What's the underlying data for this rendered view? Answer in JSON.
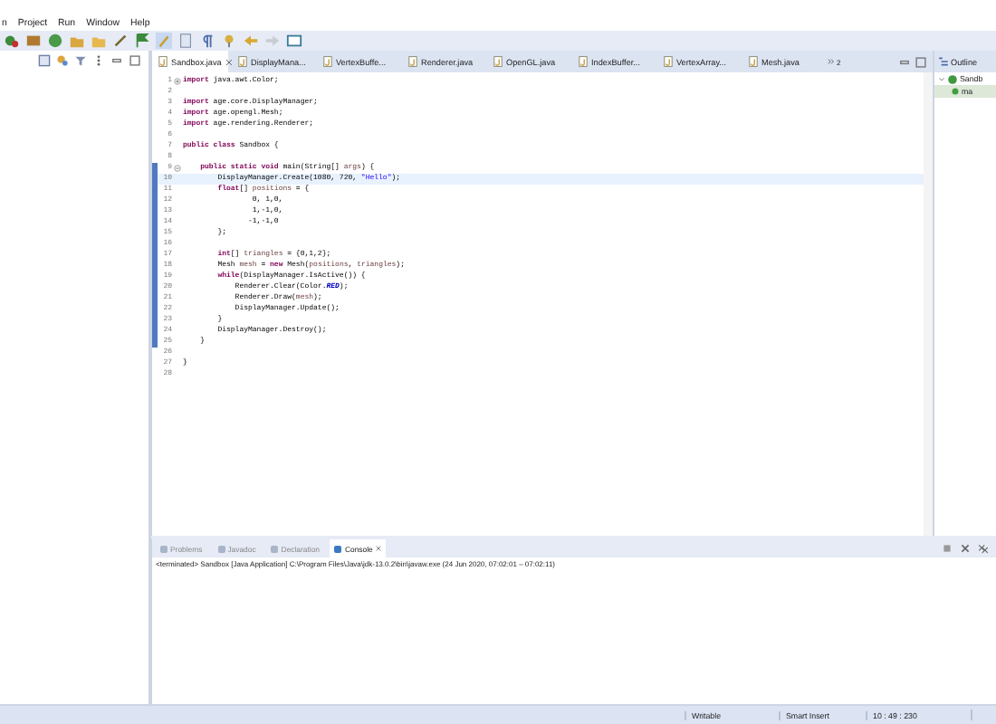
{
  "menu": [
    "n",
    "Project",
    "Run",
    "Window",
    "Help"
  ],
  "editor": {
    "tabs": [
      {
        "label": "Sandbox.java",
        "selected": true
      },
      {
        "label": "DisplayMana...",
        "selected": false
      },
      {
        "label": "VertexBuffe...",
        "selected": false
      },
      {
        "label": "Renderer.java",
        "selected": false
      },
      {
        "label": "OpenGL.java",
        "selected": false
      },
      {
        "label": "IndexBuffer...",
        "selected": false
      },
      {
        "label": "VertexArray...",
        "selected": false
      },
      {
        "label": "Mesh.java",
        "selected": false
      }
    ],
    "overflow_count": "2",
    "lines": [
      {
        "num": "1",
        "folded": true,
        "changed": false,
        "current": false,
        "segments": [
          {
            "t": "import",
            "kind": "kw"
          },
          {
            "t": " java.awt.Color;"
          }
        ]
      },
      {
        "num": "2",
        "changed": false,
        "current": false
      },
      {
        "num": "3",
        "changed": false,
        "current": false,
        "segments": [
          {
            "t": "import",
            "kind": "kw"
          },
          {
            "t": " age.core.DisplayManager;"
          }
        ]
      },
      {
        "num": "4",
        "changed": false,
        "current": false,
        "segments": [
          {
            "t": "import",
            "kind": "kw"
          },
          {
            "t": " age.opengl.Mesh;"
          }
        ]
      },
      {
        "num": "5",
        "changed": false,
        "current": false,
        "segments": [
          {
            "t": "import",
            "kind": "kw"
          },
          {
            "t": " age.rendering.Renderer;"
          }
        ]
      },
      {
        "num": "6",
        "changed": false,
        "current": false
      },
      {
        "num": "7",
        "changed": false,
        "current": false,
        "segments": [
          {
            "t": "public class",
            "kind": "kw"
          },
          {
            "t": " Sandbox {"
          }
        ]
      },
      {
        "num": "8",
        "changed": false,
        "current": false
      },
      {
        "num": "9",
        "folded": false,
        "changed": true,
        "current": false,
        "segments": [
          {
            "t": "    public static void",
            "kind": "kw"
          },
          {
            "t": " main(String[] "
          },
          {
            "t": "args",
            "kind": "var"
          },
          {
            "t": ") {"
          }
        ]
      },
      {
        "num": "10",
        "changed": true,
        "current": true,
        "segments": [
          {
            "t": "        DisplayManager.Create(1080, 720, "
          },
          {
            "t": "\"Hello\"",
            "kind": "str"
          },
          {
            "t": ");"
          }
        ]
      },
      {
        "num": "11",
        "changed": true,
        "current": false,
        "segments": [
          {
            "t": "        float",
            "kind": "kw"
          },
          {
            "t": "[] "
          },
          {
            "t": "positions",
            "kind": "var"
          },
          {
            "t": " = {"
          }
        ]
      },
      {
        "num": "12",
        "changed": true,
        "current": false,
        "segments": [
          {
            "t": "                0, 1,0,"
          }
        ]
      },
      {
        "num": "13",
        "changed": true,
        "current": false,
        "segments": [
          {
            "t": "                1,-1,0,"
          }
        ]
      },
      {
        "num": "14",
        "changed": true,
        "current": false,
        "segments": [
          {
            "t": "               -1,-1,0"
          }
        ]
      },
      {
        "num": "15",
        "changed": true,
        "current": false,
        "segments": [
          {
            "t": "        };"
          }
        ]
      },
      {
        "num": "16",
        "changed": true,
        "current": false
      },
      {
        "num": "17",
        "changed": true,
        "current": false,
        "segments": [
          {
            "t": "        int",
            "kind": "kw"
          },
          {
            "t": "[] "
          },
          {
            "t": "triangles",
            "kind": "var"
          },
          {
            "t": " = {0,1,2};"
          }
        ]
      },
      {
        "num": "18",
        "changed": true,
        "current": false,
        "segments": [
          {
            "t": "        Mesh "
          },
          {
            "t": "mesh",
            "kind": "var"
          },
          {
            "t": " = "
          },
          {
            "t": "new",
            "kind": "kw"
          },
          {
            "t": " Mesh("
          },
          {
            "t": "positions",
            "kind": "var"
          },
          {
            "t": ", "
          },
          {
            "t": "triangles",
            "kind": "var"
          },
          {
            "t": ");"
          }
        ]
      },
      {
        "num": "19",
        "changed": true,
        "current": false,
        "segments": [
          {
            "t": "        while",
            "kind": "kw"
          },
          {
            "t": "(DisplayManager.IsActive()) {"
          }
        ]
      },
      {
        "num": "20",
        "changed": true,
        "current": false,
        "segments": [
          {
            "t": "            Renderer.Clear(Color."
          },
          {
            "t": "RED",
            "kind": "const"
          },
          {
            "t": ");"
          }
        ]
      },
      {
        "num": "21",
        "changed": true,
        "current": false,
        "segments": [
          {
            "t": "            Renderer.Draw("
          },
          {
            "t": "mesh",
            "kind": "var"
          },
          {
            "t": ");"
          }
        ]
      },
      {
        "num": "22",
        "changed": true,
        "current": false,
        "segments": [
          {
            "t": "            DisplayManager.Update();"
          }
        ]
      },
      {
        "num": "23",
        "changed": true,
        "current": false,
        "segments": [
          {
            "t": "        }"
          }
        ]
      },
      {
        "num": "24",
        "changed": true,
        "current": false,
        "segments": [
          {
            "t": "        DisplayManager.Destroy();"
          }
        ]
      },
      {
        "num": "25",
        "changed": true,
        "current": false,
        "segments": [
          {
            "t": "    }"
          }
        ]
      },
      {
        "num": "26",
        "changed": false,
        "current": false
      },
      {
        "num": "27",
        "changed": false,
        "current": false,
        "segments": [
          {
            "t": "}"
          }
        ]
      },
      {
        "num": "28",
        "changed": false,
        "current": false
      }
    ]
  },
  "outline": {
    "title": "Outline",
    "tree": [
      {
        "label": "Sandb",
        "kind": "class",
        "expanded": true,
        "children": [
          {
            "label": "ma",
            "kind": "method"
          }
        ]
      }
    ]
  },
  "bottom_panel": {
    "tabs": [
      {
        "label": "Problems",
        "selected": false
      },
      {
        "label": "Javadoc",
        "selected": false
      },
      {
        "label": "Declaration",
        "selected": false
      },
      {
        "label": "Console",
        "selected": true
      }
    ],
    "console_header": "<terminated> Sandbox [Java Application] C:\\Program Files\\Java\\jdk-13.0.2\\bin\\javaw.exe  (24 Jun 2020, 07:02:01 – 07:02:11)"
  },
  "status_bar": [
    "Writable",
    "Smart Insert",
    "10 : 49 : 230"
  ]
}
